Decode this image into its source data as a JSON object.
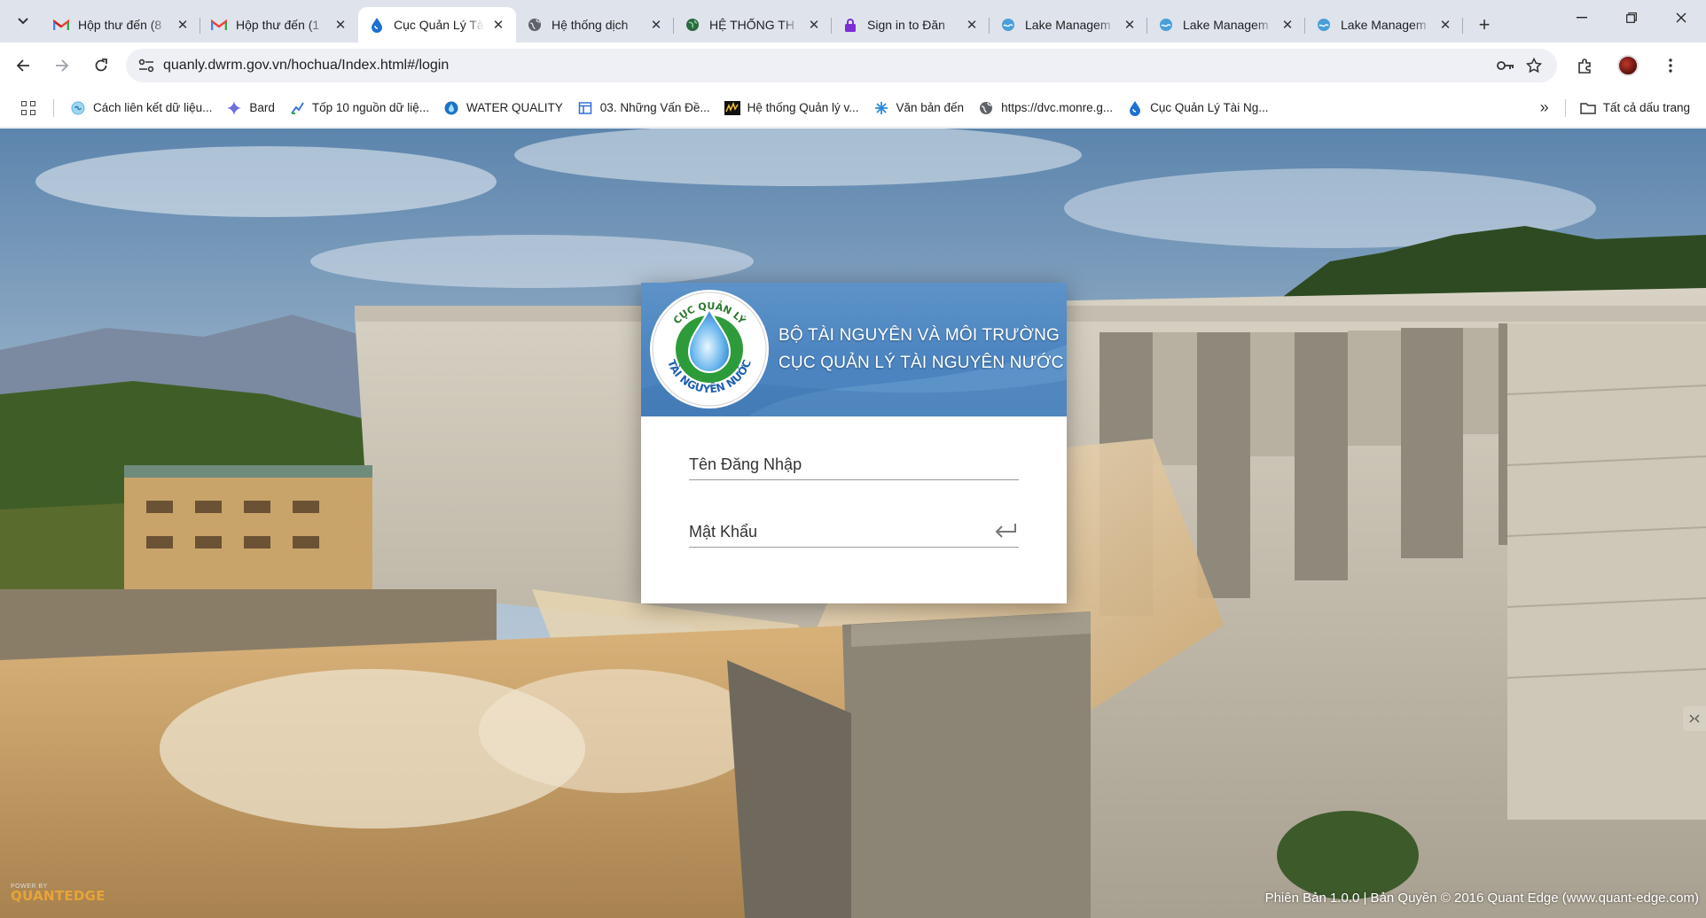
{
  "browser": {
    "tabs": [
      {
        "title": "Hộp thư đến (8",
        "icon": "gmail-icon"
      },
      {
        "title": "Hộp thư đến (1",
        "icon": "gmail-icon"
      },
      {
        "title": "Cục Quản Lý Tà",
        "icon": "drop-icon"
      },
      {
        "title": "Hệ thống dịch",
        "icon": "globe-icon"
      },
      {
        "title": "HỆ THỐNG TH",
        "icon": "earth-icon"
      },
      {
        "title": "Sign in to Đăn",
        "icon": "lock-icon"
      },
      {
        "title": "Lake Managem",
        "icon": "lake-icon"
      },
      {
        "title": "Lake Managem",
        "icon": "lake-icon"
      },
      {
        "title": "Lake Managem",
        "icon": "lake-icon"
      }
    ],
    "active_tab_index": 2,
    "new_tab_label": "+",
    "url": "quanly.dwrm.gov.vn/hochua/Index.html#/login",
    "bookmarks": [
      {
        "label": "Cách liên kết dữ liệu...",
        "icon": "link-icon"
      },
      {
        "label": "Bard",
        "icon": "sparkle-icon"
      },
      {
        "label": "Tốp 10 nguồn dữ liệ...",
        "icon": "chart-icon"
      },
      {
        "label": "WATER QUALITY",
        "icon": "drop-icon"
      },
      {
        "label": "03. Những Vấn Đề...",
        "icon": "calendar-icon"
      },
      {
        "label": "Hệ thống Quản lý v...",
        "icon": "wave-icon"
      },
      {
        "label": "Văn bản đến",
        "icon": "snowflake-icon"
      },
      {
        "label": "https://dvc.monre.g...",
        "icon": "globe-icon"
      },
      {
        "label": "Cục Quản Lý Tài Ng...",
        "icon": "drop-icon"
      }
    ],
    "all_bookmarks_label": "Tất cả dấu trang",
    "more_bookmarks_label": "»"
  },
  "login": {
    "org_line1": "BỘ TÀI NGUYÊN VÀ MÔI TRƯỜNG",
    "org_line2": "CỤC QUẢN LÝ TÀI NGUYÊN NƯỚC",
    "logo_text_top": "CỤC QUẢN LÝ",
    "logo_text_bottom": "TÀI NGUYÊN NƯỚC",
    "username_placeholder": "Tên Đăng Nhập",
    "password_placeholder": "Mật Khẩu"
  },
  "footer": {
    "powered_by": "POWER BY",
    "brand": "QUANTEDGE",
    "version_text": "Phiên Bản 1.0.0 | Bản Quyền © 2016 Quant Edge (www.quant-edge.com)"
  },
  "colors": {
    "tabstrip": "#dfe3eb",
    "header_blue": "#4c85c1",
    "logo_green": "#2e9b3a",
    "brand_orange": "#e8a33a"
  }
}
